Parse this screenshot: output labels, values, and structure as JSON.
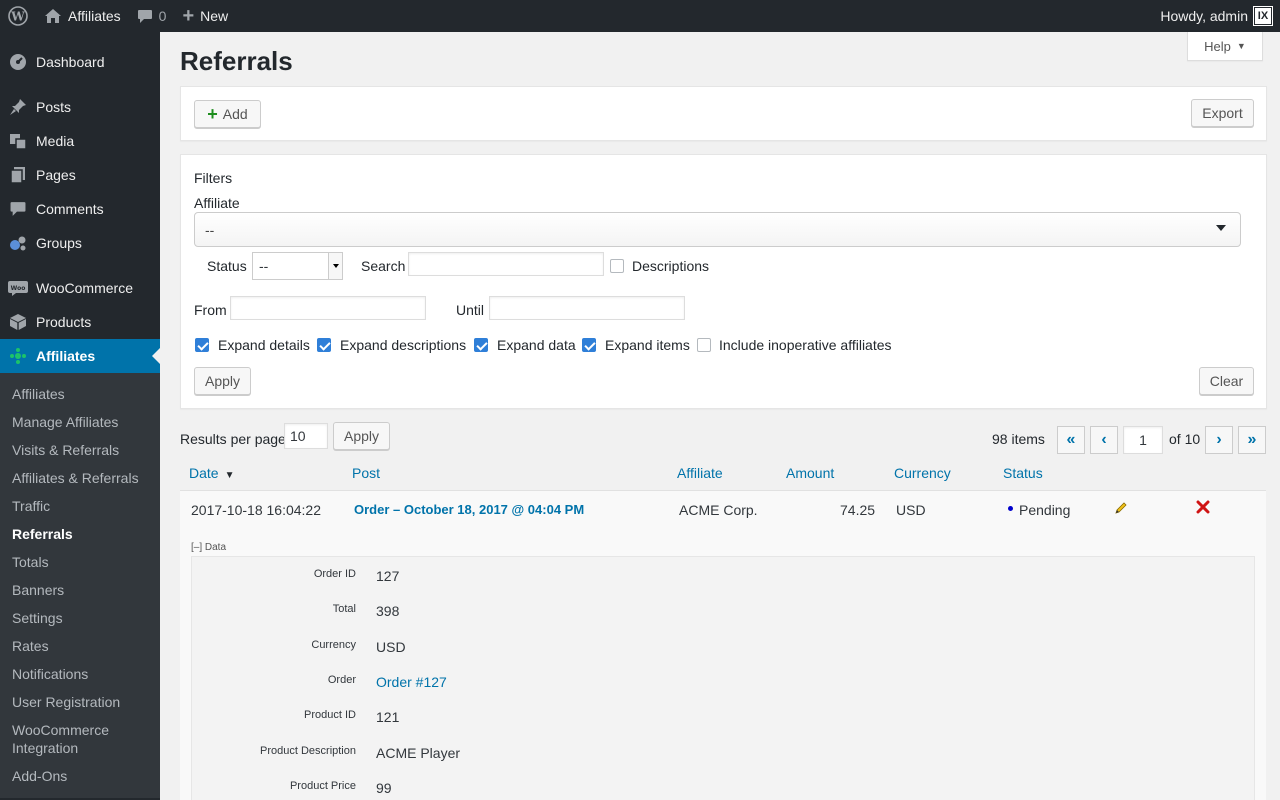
{
  "adminbar": {
    "site_name": "Affiliates",
    "comments_count": "0",
    "new_label": "New",
    "howdy": "Howdy, admin"
  },
  "sidebar": {
    "items": [
      {
        "label": "Dashboard",
        "icon": "dashboard-icon"
      },
      {
        "label": "Posts",
        "icon": "pin-icon"
      },
      {
        "label": "Media",
        "icon": "media-icon"
      },
      {
        "label": "Pages",
        "icon": "pages-icon"
      },
      {
        "label": "Comments",
        "icon": "comment-icon"
      },
      {
        "label": "Groups",
        "icon": "groups-icon"
      },
      {
        "label": "WooCommerce",
        "icon": "woocommerce-icon"
      },
      {
        "label": "Products",
        "icon": "box-icon"
      },
      {
        "label": "Affiliates",
        "icon": "affiliates-icon"
      }
    ],
    "submenu": [
      "Affiliates",
      "Manage Affiliates",
      "Visits & Referrals",
      "Affiliates & Referrals",
      "Traffic",
      "Referrals",
      "Totals",
      "Banners",
      "Settings",
      "Rates",
      "Notifications",
      "User Registration",
      "WooCommerce Integration",
      "Add-Ons"
    ]
  },
  "page": {
    "title": "Referrals",
    "help": "Help",
    "add_label": "Add",
    "export_label": "Export"
  },
  "filters": {
    "heading": "Filters",
    "affiliate_label": "Affiliate",
    "affiliate_value": "--",
    "status_label": "Status",
    "status_value": "--",
    "search_label": "Search",
    "search_value": "",
    "descriptions_label": "Descriptions",
    "from_label": "From",
    "until_label": "Until",
    "checks": [
      {
        "label": "Expand details",
        "checked": true
      },
      {
        "label": "Expand descriptions",
        "checked": true
      },
      {
        "label": "Expand data",
        "checked": true
      },
      {
        "label": "Expand items",
        "checked": true
      },
      {
        "label": "Include inoperative affiliates",
        "checked": false
      }
    ],
    "apply_label": "Apply",
    "clear_label": "Clear"
  },
  "list": {
    "results_per_page_label": "Results per page",
    "results_per_page_value": "10",
    "apply_label": "Apply",
    "items_count": "98 items",
    "page_current": "1",
    "page_of": "of 10",
    "nav": {
      "first": "«",
      "prev": "‹",
      "next": "›",
      "last": "»"
    },
    "columns": [
      "Date",
      "Post",
      "Affiliate",
      "Amount",
      "Currency",
      "Status"
    ],
    "row": {
      "date": "2017-10-18 16:04:22",
      "post": "Order – October 18, 2017 @ 04:04 PM",
      "affiliate": "ACME Corp.",
      "amount": "74.25",
      "currency": "USD",
      "status": "Pending"
    },
    "data_toggle": "[–] Data",
    "data": [
      {
        "key": "Order ID",
        "value": "127"
      },
      {
        "key": "Total",
        "value": "398"
      },
      {
        "key": "Currency",
        "value": "USD"
      },
      {
        "key": "Order",
        "value": "Order #127"
      },
      {
        "key": "Product ID",
        "value": "121"
      },
      {
        "key": "Product Description",
        "value": "ACME Player"
      },
      {
        "key": "Product Price",
        "value": "99"
      }
    ]
  }
}
